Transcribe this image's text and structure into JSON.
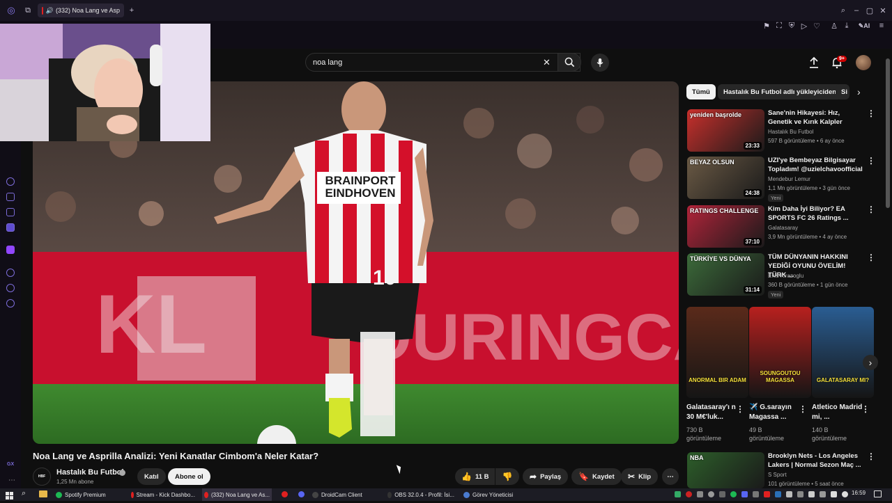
{
  "browser": {
    "tab_title": "(332) Noa Lang ve Asp",
    "new_tab": "+",
    "ai_label": "AI"
  },
  "search": {
    "query": "noa lang"
  },
  "header": {
    "notification_count": "9+"
  },
  "video": {
    "title": "Noa Lang ve Asprilla Analizi: Yeni Kanatlar Cimbom'a Neler Katar?",
    "channel": "Hastalık Bu Futbol",
    "subscribers": "1,25 Mn abone",
    "join_label": "Katıl",
    "subscribe_label": "Abone ol",
    "likes": "11 B",
    "share_label": "Paylaş",
    "save_label": "Kaydet",
    "clip_label": "Klip",
    "jersey_sponsor": "BRAINPORT EINDHOVEN",
    "jersey_number": "10"
  },
  "chips": [
    "Tümü",
    "Hastalık Bu Futbol adlı yükleyiciden",
    "Si"
  ],
  "recommendations": [
    {
      "title": "Sane'nin Hikayesi: Hız, Genetik ve Kırık Kalpler",
      "channel": "Hastalık Bu Futbol",
      "meta": "597 B görüntüleme • 6 ay önce",
      "duration": "23:33",
      "badge": "",
      "thumb_text": "yeniden başrolde",
      "color": "#c9302c"
    },
    {
      "title": "UZI'ye Bembeyaz Bilgisayar Topladım! @uzielchavoofficial",
      "channel": "Mendebur Lemur",
      "meta": "1,1 Mn görüntüleme • 3 gün önce",
      "duration": "24:38",
      "badge": "Yeni",
      "thumb_text": "BEYAZ OLSUN",
      "color": "#6b5a45"
    },
    {
      "title": "Kim Daha İyi Biliyor? EA SPORTS FC 26 Ratings ...",
      "channel": "Galatasaray",
      "meta": "3,9 Mn görüntüleme • 4 ay önce",
      "duration": "37:10",
      "badge": "",
      "thumb_text": "RATINGS CHALLENGE",
      "color": "#b2243a"
    },
    {
      "title": "TÜM DÜNYANIN HAKKINI YEDİĞİ OYUNU ÖVELİM! TÜRK ...",
      "channel": "Enis Kirazoglu",
      "meta": "360 B görüntüleme • 1 gün önce",
      "duration": "31:14",
      "badge": "Yeni",
      "thumb_text": "TÜRKİYE VS DÜNYA",
      "color": "#3c6b3a"
    },
    {
      "title": "Brooklyn Nets - Los Angeles Lakers | Normal Sezon Maç ...",
      "channel": "S Sport",
      "meta": "101 görüntüleme • 5 saat önce",
      "duration": "",
      "badge": "",
      "thumb_text": "NBA",
      "color": "#2d5e2a"
    }
  ],
  "shorts": [
    {
      "title": "Galatasaray'ı n 30 M€'luk...",
      "views": "730 B",
      "views_label": "görüntüleme",
      "thumb_text": "ANORMAL BIR ADAM",
      "color": "#5a2a1a"
    },
    {
      "title": "✈️ G.sarayın Magassa ...",
      "views": "49 B",
      "views_label": "görüntüleme",
      "thumb_text": "SOUNGOUTOU MAGASSA",
      "color": "#b8201e"
    },
    {
      "title": "Atletico Madrid mi, ...",
      "views": "140 B",
      "views_label": "görüntüleme",
      "thumb_text": "GALATASARAY MI?",
      "color": "#2a5d92"
    }
  ],
  "taskbar": {
    "items": [
      {
        "label": "Spotify Premium",
        "color": "#1db954"
      },
      {
        "label": "Stream - Kick Dashbo...",
        "color": "#e02020"
      },
      {
        "label": "(332) Noa Lang ve As...",
        "color": "#e02020"
      },
      {
        "label": "DroidCam Client",
        "color": "#444"
      },
      {
        "label": "OBS 32.0.4 - Profil: İsi...",
        "color": "#333"
      },
      {
        "label": "Görev Yöneticisi",
        "color": "#4a7bd0"
      }
    ],
    "clock": "16:59"
  }
}
